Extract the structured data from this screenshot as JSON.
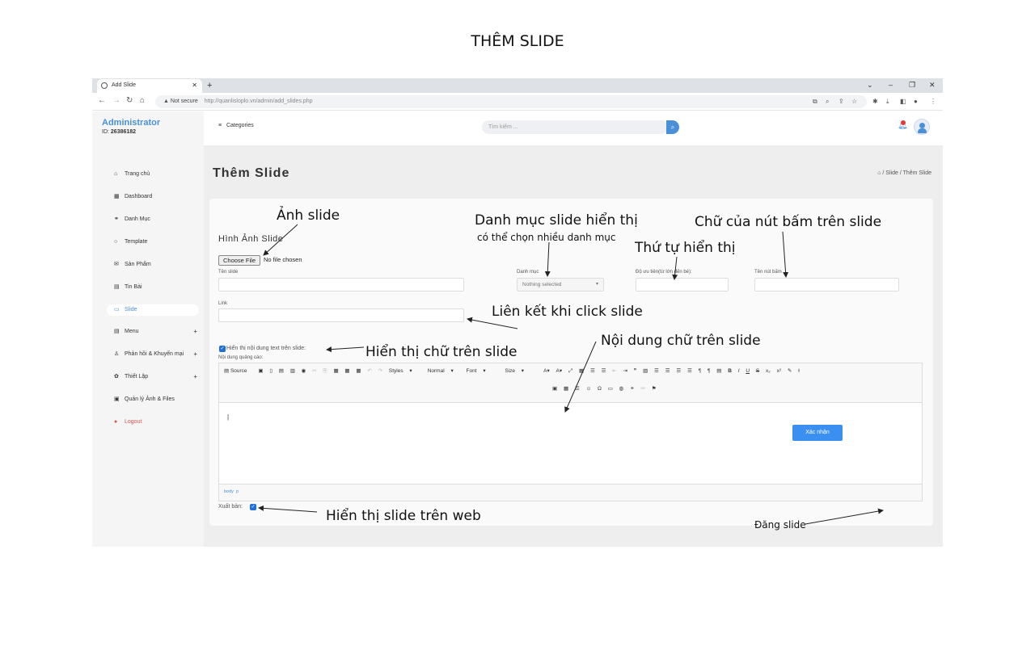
{
  "doc_title": "THÊM SLIDE",
  "browser": {
    "tab_title": "Add Slide",
    "new_tab": "+",
    "not_secure": "Not secure",
    "url": "http://quanlisloplo.vn/admin/add_slides.php"
  },
  "sidebar": {
    "title": "Administrator",
    "id_label": "ID:",
    "id_value": "26386182",
    "items": [
      {
        "label": "Trang chủ",
        "icon": "home-icon"
      },
      {
        "label": "Dashboard",
        "icon": "grid-icon"
      },
      {
        "label": "Danh Mục",
        "icon": "link-icon"
      },
      {
        "label": "Template",
        "icon": "circle-icon"
      },
      {
        "label": "Sản Phẩm",
        "icon": "mail-icon"
      },
      {
        "label": "Tin Bài",
        "icon": "doc-icon"
      },
      {
        "label": "Slide",
        "icon": "monitor-icon",
        "active": true
      },
      {
        "label": "Menu",
        "icon": "menu-icon",
        "expand": "+"
      },
      {
        "label": "Phản hồi & Khuyến mại",
        "icon": "user-icon",
        "expand": "+"
      },
      {
        "label": "Thiết Lập",
        "icon": "gear-icon",
        "expand": "+"
      },
      {
        "label": "Quản lý Ảnh & Files",
        "icon": "images-icon"
      },
      {
        "label": "Logout",
        "icon": "logout-icon"
      }
    ]
  },
  "topnav": {
    "categories": "Categories",
    "search_placeholder": "Tìm kiếm ..."
  },
  "page": {
    "title": "Thêm Slide",
    "breadcrumb_1": "Slide",
    "breadcrumb_2": "Thêm Slide"
  },
  "form": {
    "section_title": "Hình Ảnh Slide",
    "choose_file": "Choose File",
    "no_file": "No file chosen",
    "ten_slide_label": "Tên slide",
    "danh_muc_label": "Danh mục",
    "danh_muc_value": "Nothing selected",
    "uu_tien_label": "Độ ưu tiên(từ lớn đến bé):",
    "ten_nut_label": "Tên nút bấm",
    "link_label": "Link",
    "show_text_label": "Hiển thị nội dung text trên slide:",
    "noi_dung_label": "Nội dung quảng cáo:",
    "xuat_ban_label": "Xuất bản:",
    "submit": "Xác nhận"
  },
  "editor": {
    "source": "Source",
    "styles": "Styles",
    "format": "Normal",
    "font": "Font",
    "size": "Size",
    "path_body": "body",
    "path_p": "p"
  },
  "annotations": {
    "anh_slide": "Ảnh slide",
    "danh_muc": "Danh mục slide hiển thị",
    "danh_muc_sub": "có thể chọn nhiều danh mục",
    "thu_tu": "Thứ tự hiển thị",
    "chu_nut": "Chữ của nút bấm trên slide",
    "lien_ket": "Liên kết khi click slide",
    "noi_dung": "Nội dung chữ trên slide",
    "hien_thi_chu": "Hiển thị chữ trên slide",
    "hien_thi_web": "Hiển thị slide trên web",
    "dang_slide": "Đăng slide"
  },
  "colors": {
    "accent": "#3b8ff0",
    "logout": "#d9534f"
  }
}
